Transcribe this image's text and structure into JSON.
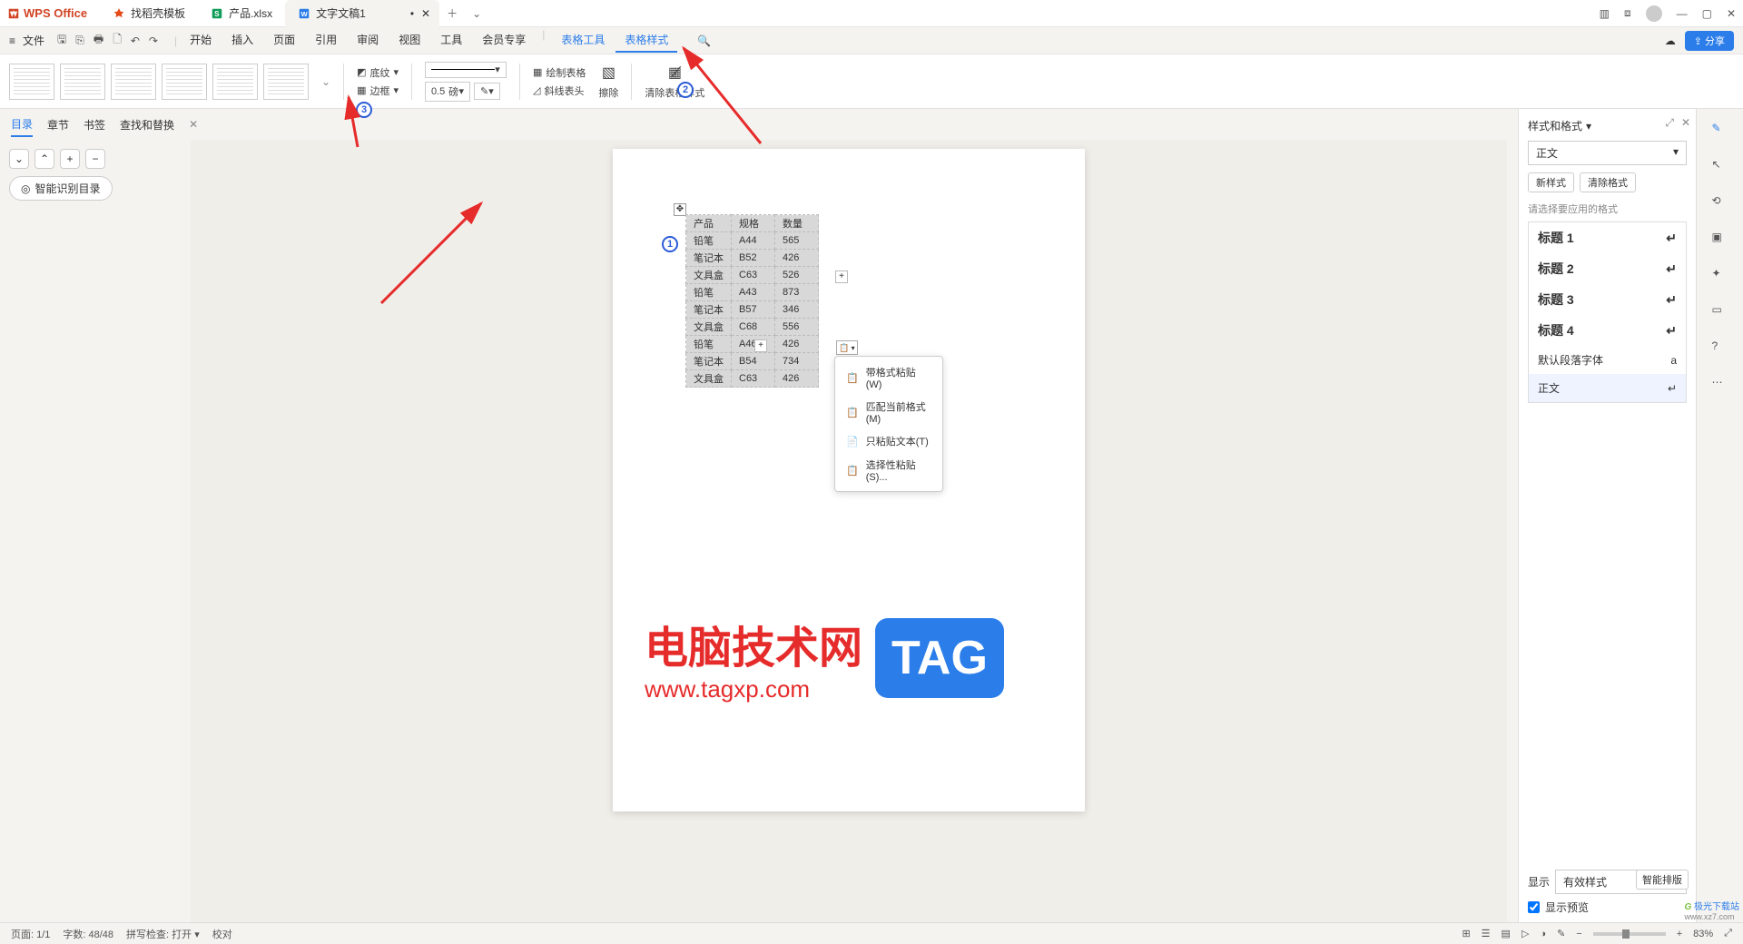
{
  "app_name": "WPS Office",
  "tabs": [
    {
      "label": "找稻壳模板",
      "kind": "docer"
    },
    {
      "label": "产品.xlsx",
      "kind": "sheet"
    },
    {
      "label": "文字文稿1",
      "kind": "writer",
      "active": true,
      "dirty": true
    }
  ],
  "menubar": {
    "file": "文件",
    "items": [
      "开始",
      "插入",
      "页面",
      "引用",
      "审阅",
      "视图",
      "工具",
      "会员专享"
    ],
    "context_items": [
      "表格工具",
      "表格样式"
    ]
  },
  "ribbon": {
    "shading": "底纹",
    "border": "边框",
    "line_weight_value": "0.5",
    "line_weight_unit": "磅",
    "draw_table": "绘制表格",
    "diagonal": "斜线表头",
    "erase": "擦除",
    "clear_style": "清除表格样式"
  },
  "left_nav": {
    "tabs": [
      "目录",
      "章节",
      "书签",
      "查找和替换"
    ],
    "smart_toc": "智能识别目录"
  },
  "table": {
    "headers": [
      "产品",
      "规格",
      "数量"
    ],
    "rows": [
      [
        "铅笔",
        "A44",
        "565"
      ],
      [
        "笔记本",
        "B52",
        "426"
      ],
      [
        "文具盒",
        "C63",
        "526"
      ],
      [
        "铅笔",
        "A43",
        "873"
      ],
      [
        "笔记本",
        "B57",
        "346"
      ],
      [
        "文具盒",
        "C68",
        "556"
      ],
      [
        "铅笔",
        "A46",
        "426"
      ],
      [
        "笔记本",
        "B54",
        "734"
      ],
      [
        "文具盒",
        "C63",
        "426"
      ]
    ]
  },
  "paste_menu": {
    "items": [
      "带格式粘贴(W)",
      "匹配当前格式(M)",
      "只粘贴文本(T)",
      "选择性粘贴(S)..."
    ]
  },
  "right_panel": {
    "title": "样式和格式",
    "current": "正文",
    "new_style": "新样式",
    "clear_format": "清除格式",
    "hint": "请选择要应用的格式",
    "styles": [
      "标题 1",
      "标题 2",
      "标题 3",
      "标题 4",
      "默认段落字体",
      "正文"
    ],
    "display_label": "显示",
    "display_value": "有效样式",
    "preview": "显示预览",
    "smart_layout": "智能排版"
  },
  "statusbar": {
    "page": "页面: 1/1",
    "words": "字数: 48/48",
    "spell": "拼写检查: 打开",
    "proof": "校对",
    "zoom": "83%"
  },
  "share": "分享",
  "watermark": {
    "line1": "电脑技术网",
    "line2": "www.tagxp.com",
    "tag": "TAG"
  },
  "corner_brand": "极光下载站"
}
